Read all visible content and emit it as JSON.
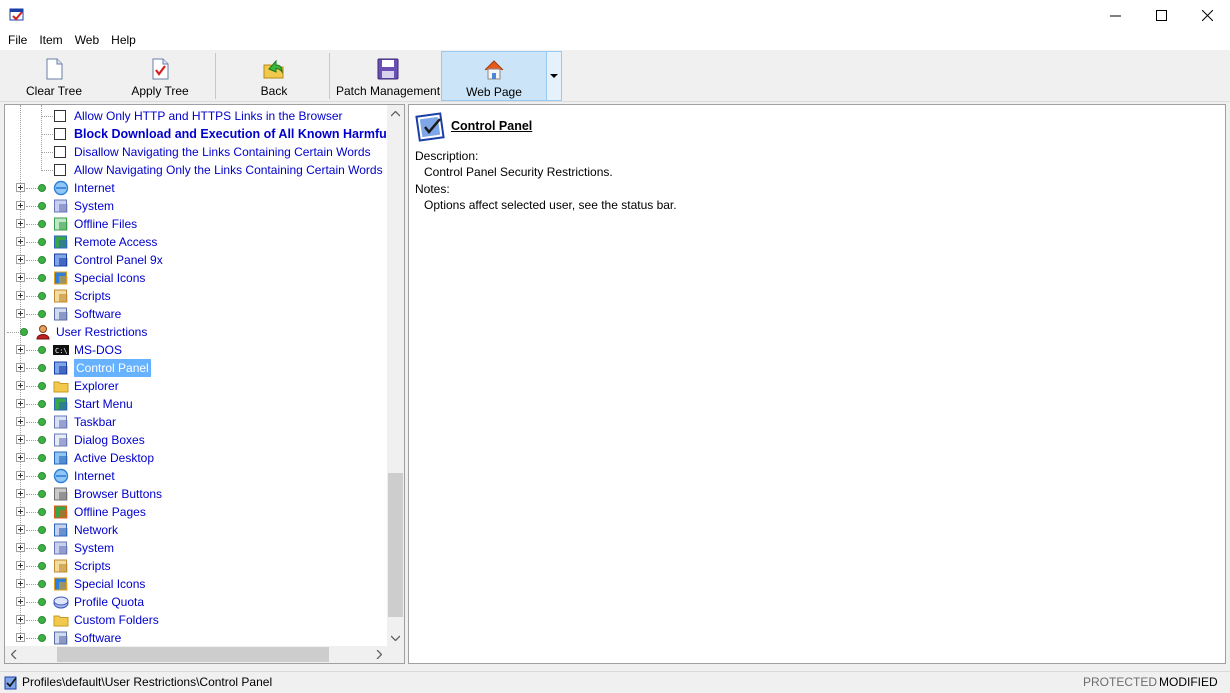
{
  "menu": [
    "File",
    "Item",
    "Web",
    "Help"
  ],
  "toolbar": {
    "clear_tree": "Clear Tree",
    "apply_tree": "Apply Tree",
    "back": "Back",
    "patch_management": "Patch Management",
    "web_page": "Web Page"
  },
  "tree": {
    "checkbox_items": [
      {
        "label": "Allow Only HTTP and HTTPS Links in the Browser",
        "bold": false
      },
      {
        "label": "Block Download and Execution of All Known Harmful Fi",
        "bold": true
      },
      {
        "label": "Disallow Navigating the Links Containing Certain Words",
        "bold": false
      },
      {
        "label": "Allow Navigating Only the Links Containing Certain Words",
        "bold": false
      }
    ],
    "upper_group": [
      {
        "label": "Internet",
        "icon": "internet-icon"
      },
      {
        "label": "System",
        "icon": "system-icon"
      },
      {
        "label": "Offline Files",
        "icon": "offline-files-icon"
      },
      {
        "label": "Remote Access",
        "icon": "remote-access-icon"
      },
      {
        "label": "Control Panel 9x",
        "icon": "control-panel-icon"
      },
      {
        "label": "Special Icons",
        "icon": "special-icons-icon"
      },
      {
        "label": "Scripts",
        "icon": "scripts-icon"
      },
      {
        "label": "Software",
        "icon": "software-icon"
      }
    ],
    "user_restrictions": "User Restrictions",
    "user_group": [
      {
        "label": "MS-DOS",
        "icon": "ms-dos-icon"
      },
      {
        "label": "Control Panel",
        "icon": "control-panel-icon",
        "selected": true
      },
      {
        "label": "Explorer",
        "icon": "explorer-folder-icon"
      },
      {
        "label": "Start Menu",
        "icon": "start-menu-icon"
      },
      {
        "label": "Taskbar",
        "icon": "taskbar-icon"
      },
      {
        "label": "Dialog Boxes",
        "icon": "dialog-boxes-icon"
      },
      {
        "label": "Active Desktop",
        "icon": "active-desktop-icon"
      },
      {
        "label": "Internet",
        "icon": "internet-icon"
      },
      {
        "label": "Browser Buttons",
        "icon": "browser-buttons-icon"
      },
      {
        "label": "Offline Pages",
        "icon": "offline-pages-icon"
      },
      {
        "label": "Network",
        "icon": "network-icon"
      },
      {
        "label": "System",
        "icon": "system-icon"
      },
      {
        "label": "Scripts",
        "icon": "scripts-icon"
      },
      {
        "label": "Special Icons",
        "icon": "special-icons-icon"
      },
      {
        "label": "Profile Quota",
        "icon": "profile-quota-icon"
      },
      {
        "label": "Custom Folders",
        "icon": "custom-folders-icon"
      },
      {
        "label": "Software",
        "icon": "software-icon"
      }
    ]
  },
  "info": {
    "title": "Control Panel",
    "description_label": "Description:",
    "description": "Control Panel Security Restrictions.",
    "notes_label": "Notes:",
    "notes": "Options affect selected user, see the status bar."
  },
  "status": {
    "path": "Profiles\\default\\User Restrictions\\Control Panel",
    "protected": "PROTECTED",
    "modified": "MODIFIED"
  },
  "colors": {
    "tree_text": "#0000cc",
    "status_dot": "#3cb043",
    "toolbar_active": "#cce4f7",
    "selection": "#3399ff"
  }
}
